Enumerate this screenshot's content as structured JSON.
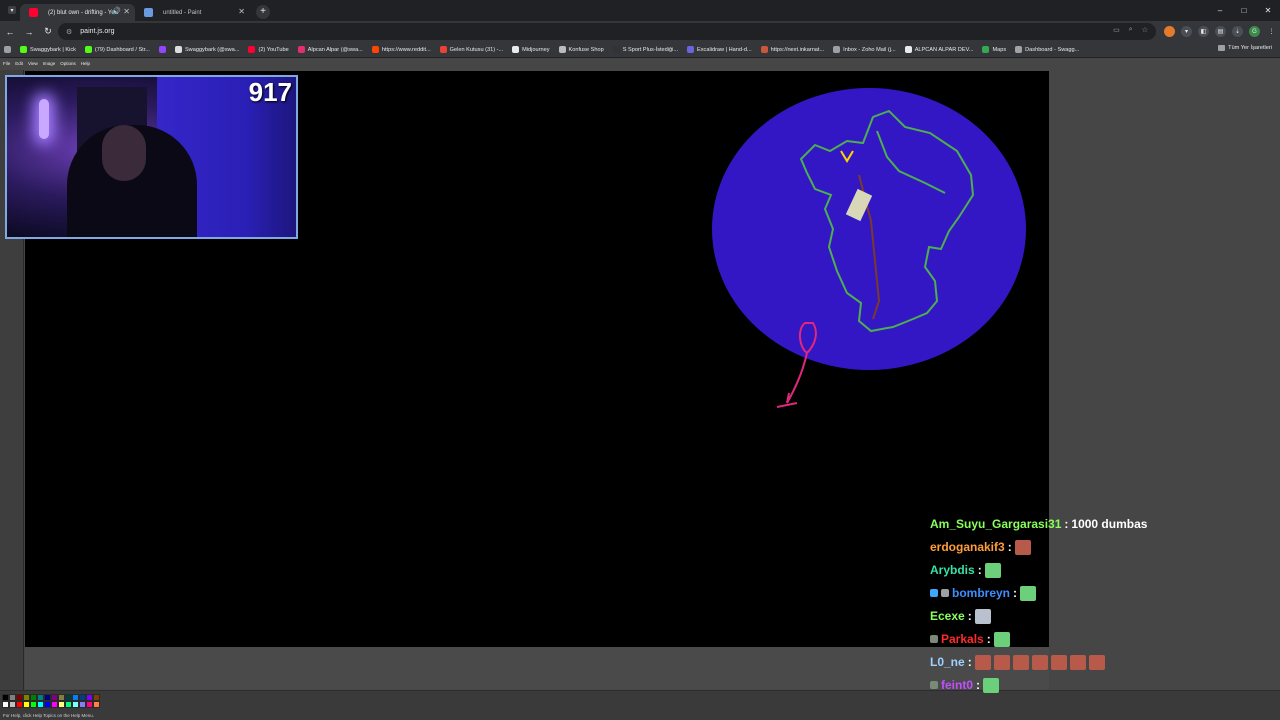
{
  "browser": {
    "tabs": [
      {
        "title": "(2) blut own - drifting - You",
        "active": true
      },
      {
        "title": "untitled - Paint",
        "active": false
      }
    ],
    "url": "paint.js.org",
    "bookmarks": [
      "Swaggybark | Kick",
      "(79) Dashboard / Str...",
      "Swaggybark (@swa...",
      "(2) YouTube",
      "Alpcan Alpar (@swa...",
      "https://www.reddit...",
      "Gelen Kutusu (31) -...",
      "Midjourney",
      "Konfuse Shop",
      "S Sport Plus-İstediği...",
      "Excalidraw | Hand-d...",
      "https://next.inkarnat...",
      "Inbox - Zoho Mail (j...",
      "ALPCAN ALPAR DEV...",
      "Maps",
      "Dashboard - Swagg..."
    ],
    "all_bookmarks_label": "Tüm Yer İşaretleri"
  },
  "paint": {
    "menu": [
      "File",
      "Edit",
      "View",
      "Image",
      "Options",
      "Help"
    ],
    "status_text": "For Help, click Help Topics on the Help Menu.",
    "palette": [
      "#000000",
      "#808080",
      "#800000",
      "#808000",
      "#008000",
      "#008080",
      "#000080",
      "#800080",
      "#808040",
      "#004040",
      "#0080ff",
      "#004080",
      "#8000ff",
      "#804000",
      "#ffffff",
      "#c0c0c0",
      "#ff0000",
      "#ffff00",
      "#00ff00",
      "#00ffff",
      "#0000ff",
      "#ff00ff",
      "#ffff80",
      "#00ff80",
      "#80ffff",
      "#8080ff",
      "#ff0080",
      "#ff8040"
    ]
  },
  "webcam": {
    "viewer_count": "917"
  },
  "chat": [
    {
      "user": "Am_Suyu_Gargarasi31",
      "color": "#8aff5c",
      "message": "1000 dumbas",
      "emotes": []
    },
    {
      "user": "erdoganakif3",
      "color": "#ff9d3b",
      "message": "",
      "emotes": [
        "red"
      ]
    },
    {
      "user": "Arybdis",
      "color": "#37e0a6",
      "message": "",
      "emotes": [
        "green"
      ]
    },
    {
      "user": "bombreyn",
      "color": "#3c8fff",
      "message": "",
      "emotes": [
        "green"
      ]
    },
    {
      "user": "Ecexe",
      "color": "#8aff5c",
      "message": "",
      "emotes": [
        "grey"
      ]
    },
    {
      "user": "Parkals",
      "color": "#ff2a2a",
      "message": "",
      "emotes": [
        "green"
      ]
    },
    {
      "user": "L0_ne",
      "color": "#9fd1ff",
      "message": "",
      "emotes": [
        "red",
        "red",
        "red",
        "red",
        "red",
        "red",
        "red"
      ]
    },
    {
      "user": "feint0",
      "color": "#c24fff",
      "message": "",
      "emotes": [
        "green"
      ]
    }
  ]
}
